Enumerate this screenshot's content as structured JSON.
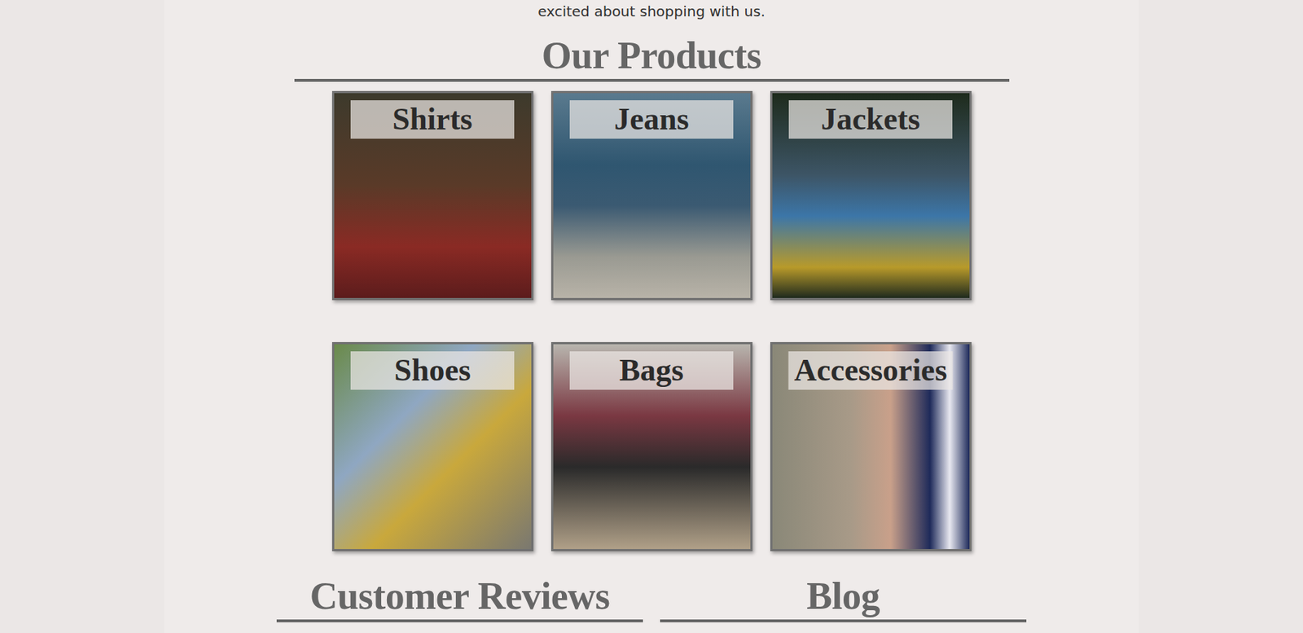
{
  "intro": {
    "text": "excited about shopping with us."
  },
  "products": {
    "title": "Our Products",
    "items": [
      {
        "label": "Shirts"
      },
      {
        "label": "Jeans"
      },
      {
        "label": "Jackets"
      },
      {
        "label": "Shoes"
      },
      {
        "label": "Bags"
      },
      {
        "label": "Accessories"
      }
    ]
  },
  "sections": [
    {
      "title": "Customer Reviews"
    },
    {
      "title": "Blog"
    }
  ]
}
